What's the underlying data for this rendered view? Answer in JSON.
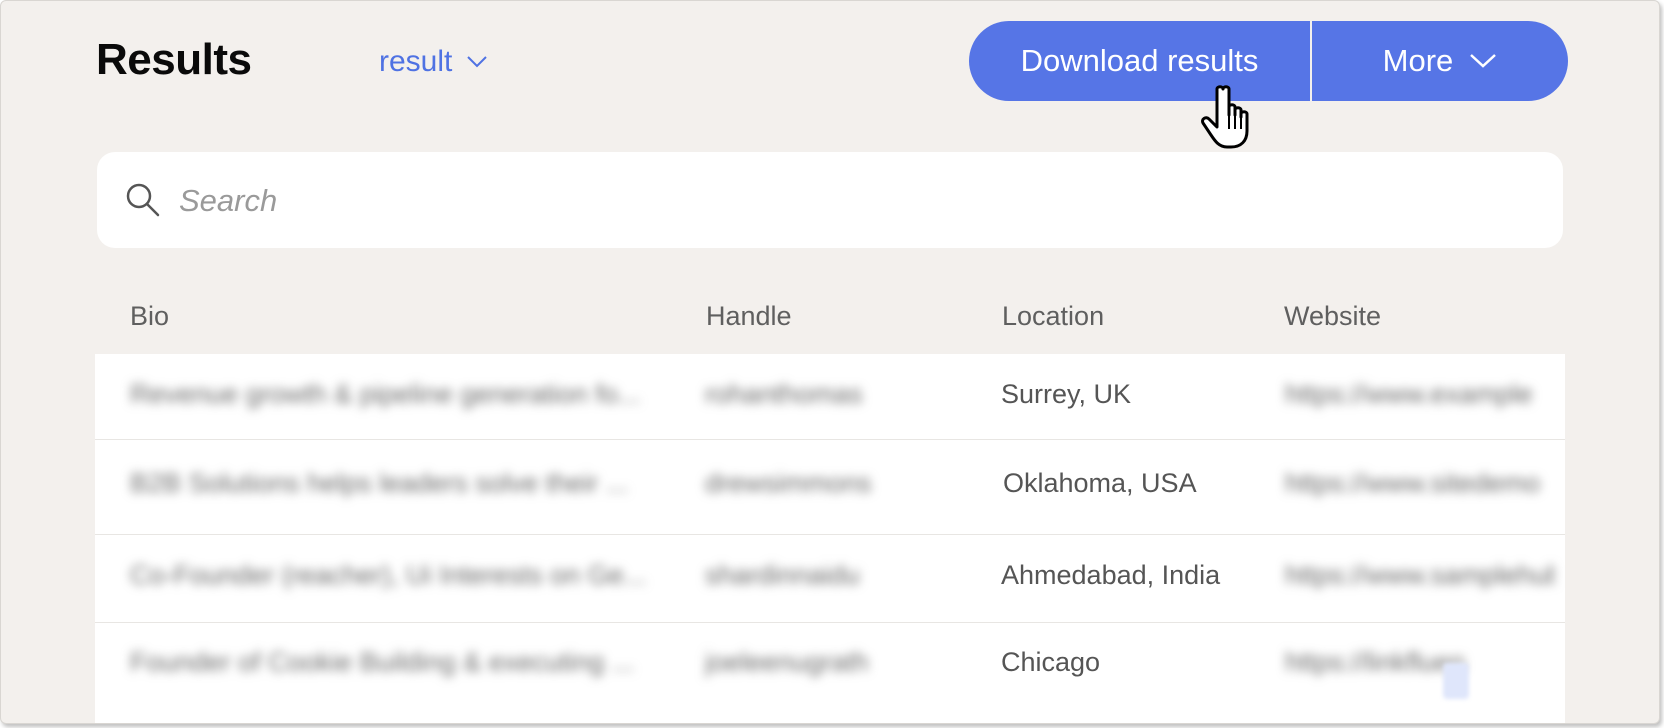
{
  "header": {
    "title": "Results",
    "dropdown_label": "result",
    "download_label": "Download results",
    "more_label": "More"
  },
  "search": {
    "placeholder": "Search"
  },
  "table": {
    "columns": [
      "Bio",
      "Handle",
      "Location",
      "Website"
    ],
    "rows": [
      {
        "bio": "Revenue growth & pipeline generation fo...",
        "handle": "rohanthomas",
        "location": "Surrey, UK",
        "website": "https://www.example"
      },
      {
        "bio": "B2B Solutions helps leaders solve their ...",
        "handle": "drewsimmons",
        "location": "Oklahoma, USA",
        "website": "https://www.sitedemo"
      },
      {
        "bio": "Co-Founder (reacher), Ui Interests on Ge...",
        "handle": "shardinnaidu",
        "location": "Ahmedabad, India",
        "website": "https://www.samplehub"
      },
      {
        "bio": "Founder of Cookie Building & executing ...",
        "handle": "joeleenugrath",
        "location": "Chicago",
        "website": "https://linkfluen"
      }
    ]
  },
  "colors": {
    "accent": "#5675e6",
    "background": "#f3f0ed",
    "link": "#4f72e3"
  }
}
